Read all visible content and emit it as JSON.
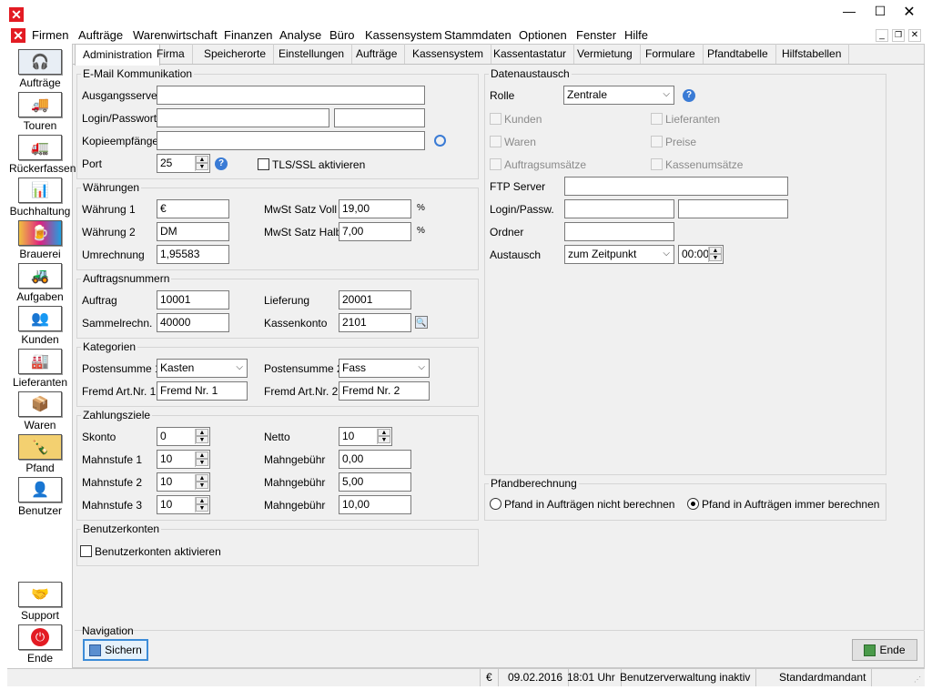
{
  "menu": {
    "items": [
      "Firmen",
      "Aufträge",
      "Warenwirtschaft",
      "Finanzen",
      "Analyse",
      "Büro",
      "Kassensystem",
      "Stammdaten",
      "Optionen",
      "Fenster",
      "Hilfe"
    ]
  },
  "sidebar": {
    "items": [
      {
        "label": "Aufträge",
        "icon": "phone-operator-icon"
      },
      {
        "label": "Touren",
        "icon": "truck-icon"
      },
      {
        "label": "Rückerfassen",
        "icon": "truck-return-icon"
      },
      {
        "label": "Buchhaltung",
        "icon": "bookkeeping-icon"
      },
      {
        "label": "Brauerei",
        "icon": "brewery-icon"
      },
      {
        "label": "Aufgaben",
        "icon": "tasks-icon"
      },
      {
        "label": "Kunden",
        "icon": "customers-icon"
      },
      {
        "label": "Lieferanten",
        "icon": "suppliers-icon"
      },
      {
        "label": "Waren",
        "icon": "goods-icon"
      },
      {
        "label": "Pfand",
        "icon": "deposit-crate-icon"
      },
      {
        "label": "Benutzer",
        "icon": "user-icon"
      }
    ],
    "bottom": [
      {
        "label": "Support",
        "icon": "handshake-icon"
      },
      {
        "label": "Ende",
        "icon": "power-icon"
      }
    ]
  },
  "tabs": [
    "Administration",
    "Firma",
    "Speicherorte",
    "Einstellungen",
    "Aufträge",
    "Kassensystem",
    "Kassentastatur",
    "Vermietung",
    "Formulare",
    "Pfandtabelle",
    "Hilfstabellen"
  ],
  "email": {
    "title": "E-Mail Kommunikation",
    "server_label": "Ausgangsserver",
    "server": "",
    "login_label": "Login/Passwort",
    "login": "",
    "password": "",
    "cc_label": "Kopieempfänger",
    "cc": "",
    "port_label": "Port",
    "port": "25",
    "tls_label": "TLS/SSL aktivieren"
  },
  "currency": {
    "title": "Währungen",
    "w1_label": "Währung 1",
    "w1": "€",
    "w2_label": "Währung 2",
    "w2": "DM",
    "conv_label": "Umrechnung",
    "conv": "1,95583",
    "vat_full_label": "MwSt Satz Voll",
    "vat_full": "19,00",
    "vat_half_label": "MwSt Satz Halb",
    "vat_half": "7,00",
    "pct": "%"
  },
  "ordernum": {
    "title": "Auftragsnummern",
    "order_label": "Auftrag",
    "order": "10001",
    "collect_label": "Sammelrechn.",
    "collect": "40000",
    "delivery_label": "Lieferung",
    "delivery": "20001",
    "till_label": "Kassenkonto",
    "till": "2101"
  },
  "categories": {
    "title": "Kategorien",
    "sum1_label": "Postensumme 1",
    "sum1": "Kasten",
    "sum2_label": "Postensumme 2",
    "sum2": "Fass",
    "foreign1_label": "Fremd Art.Nr. 1",
    "foreign1": "Fremd Nr. 1",
    "foreign2_label": "Fremd Art.Nr. 2",
    "foreign2": "Fremd Nr. 2"
  },
  "payment": {
    "title": "Zahlungsziele",
    "skonto_label": "Skonto",
    "skonto": "0",
    "netto_label": "Netto",
    "netto": "10",
    "dun1_label": "Mahnstufe 1",
    "dun1": "10",
    "dun2_label": "Mahnstufe 2",
    "dun2": "10",
    "dun3_label": "Mahnstufe 3",
    "dun3": "10",
    "fee_label": "Mahngebühr",
    "fee1": "0,00",
    "fee2": "5,00",
    "fee3": "10,00"
  },
  "users": {
    "title": "Benutzerkonten",
    "enable_label": "Benutzerkonten aktivieren"
  },
  "exchange": {
    "title": "Datenaustausch",
    "role_label": "Rolle",
    "role": "Zentrale",
    "customers": "Kunden",
    "suppliers": "Lieferanten",
    "goods": "Waren",
    "prices": "Preise",
    "order_sales": "Auftragsumsätze",
    "till_sales": "Kassenumsätze",
    "ftp_label": "FTP Server",
    "ftp": "",
    "login_label": "Login/Passw.",
    "login": "",
    "password": "",
    "folder_label": "Ordner",
    "folder": "",
    "mode_label": "Austausch",
    "mode": "zum Zeitpunkt",
    "time": "00:00"
  },
  "deposit": {
    "title": "Pfandberechnung",
    "opt_no": "Pfand in Aufträgen nicht berechnen",
    "opt_yes": "Pfand in Aufträgen immer berechnen"
  },
  "nav": {
    "title": "Navigation",
    "save": "Sichern",
    "end": "Ende"
  },
  "status": {
    "currency": "€",
    "date": "09.02.2016",
    "time": "18:01 Uhr",
    "user_mgmt": "Benutzerverwaltung inaktiv",
    "tenant": "Standardmandant"
  },
  "colors": {
    "app_red": "#e31b23",
    "panel": "#f0f0f0",
    "help_blue": "#3a7bd5"
  }
}
